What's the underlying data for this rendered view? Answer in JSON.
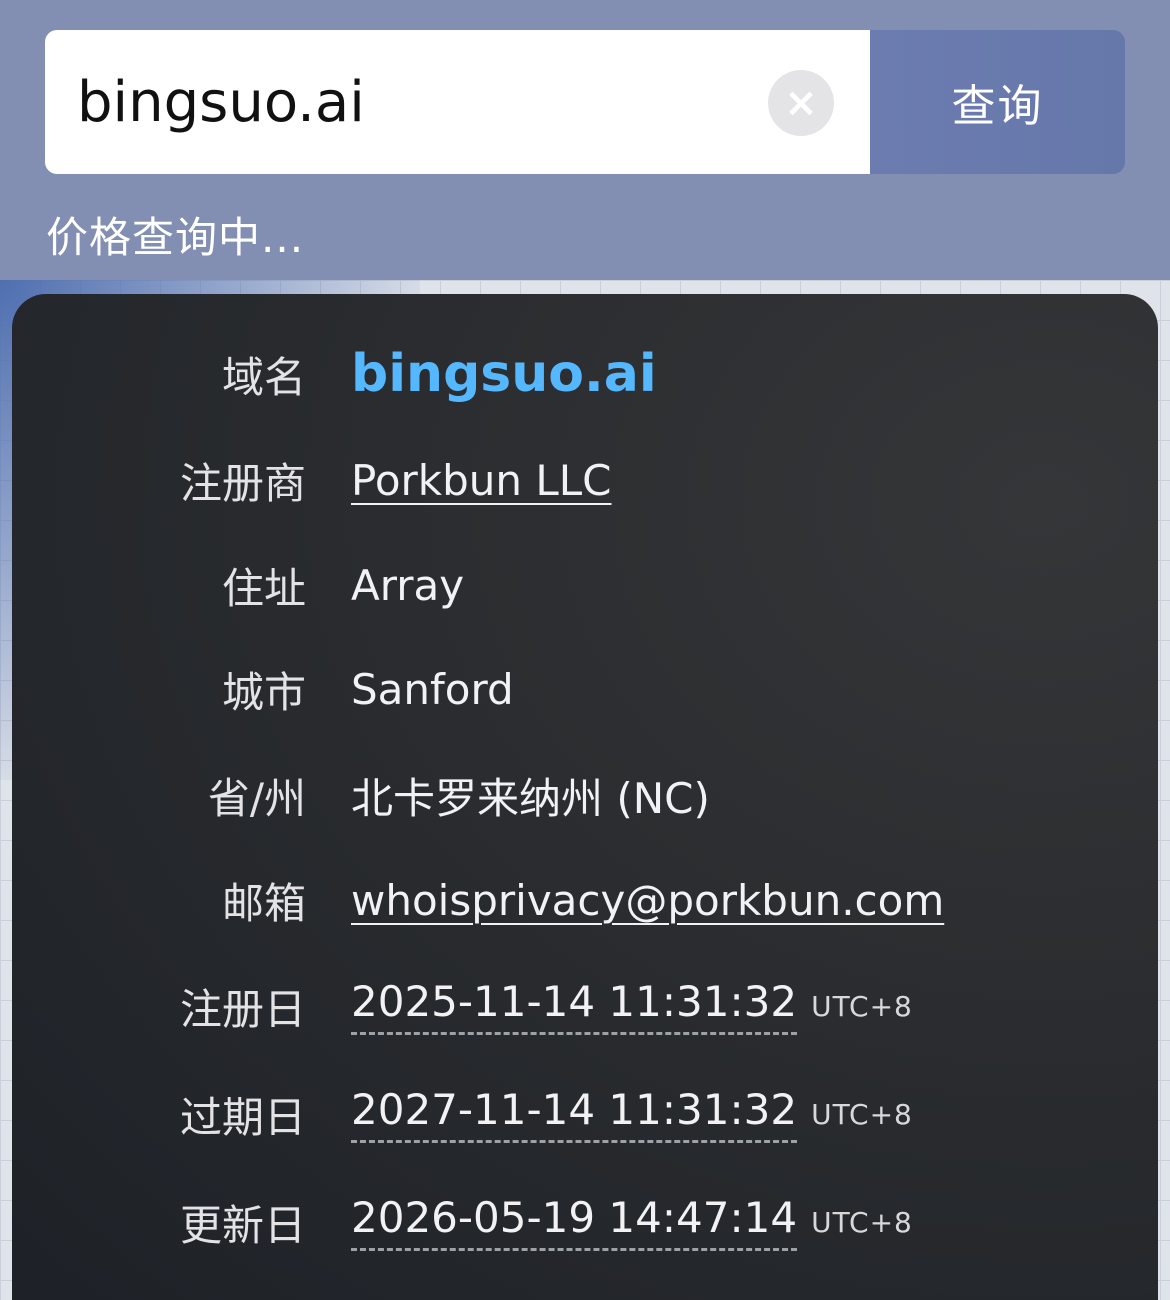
{
  "search": {
    "value": "bingsuo.ai",
    "clear_icon": "×",
    "button_label": "查询"
  },
  "status": "价格查询中...",
  "whois": {
    "domain_label": "域名",
    "domain_value": "bingsuo.ai",
    "registrar_label": "注册商",
    "registrar_value": "Porkbun LLC",
    "address_label": "住址",
    "address_value": "Array",
    "city_label": "城市",
    "city_value": "Sanford",
    "state_label": "省/州",
    "state_value": "北卡罗来纳州 (NC)",
    "email_label": "邮箱",
    "email_value": "whoisprivacy@porkbun.com",
    "registered_label": "注册日",
    "registered_value": "2025-11-14 11:31:32",
    "registered_tz": "UTC+8",
    "expires_label": "过期日",
    "expires_value": "2027-11-14 11:31:32",
    "expires_tz": "UTC+8",
    "updated_label": "更新日",
    "updated_value": "2026-05-19 14:47:14",
    "updated_tz": "UTC+8"
  },
  "colors": {
    "header_bg": "#828fb2",
    "query_button": "#6c7cb0",
    "domain_accent": "#55b8ff",
    "card_bg": "#2b2d30"
  }
}
